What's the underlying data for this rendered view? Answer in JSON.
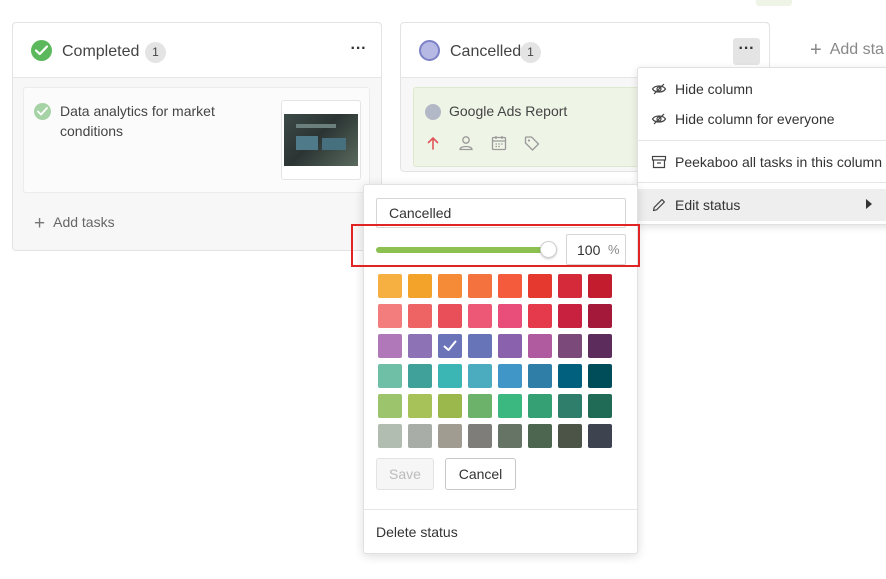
{
  "board": {
    "add_status_label": "Add sta",
    "columns": [
      {
        "title": "Completed",
        "count": "1",
        "more_label": "···",
        "tasks": [
          {
            "title": "Data analytics for market conditions"
          }
        ],
        "add_tasks_label": "Add tasks"
      },
      {
        "title": "Cancelled",
        "count": "1",
        "more_label": "···",
        "tasks": [
          {
            "title": "Google Ads Report"
          }
        ]
      }
    ]
  },
  "column_menu": {
    "items": [
      {
        "label": "Hide column",
        "icon": "eye-off-icon"
      },
      {
        "label": "Hide column for everyone",
        "icon": "eye-off-icon"
      },
      {
        "label": "Peekaboo all tasks in this column",
        "icon": "archive-icon"
      },
      {
        "label": "Edit status",
        "icon": "pencil-icon",
        "highlighted": true
      }
    ]
  },
  "edit_status_panel": {
    "name_value": "Cancelled",
    "opacity_value": "100",
    "opacity_unit": "%",
    "opacity_fraction": 1.0,
    "selected_color": "#6b74b8",
    "swatches": [
      "#f6b042",
      "#f4a32a",
      "#f68b37",
      "#f4723d",
      "#f45a3c",
      "#e5382f",
      "#d52a3a",
      "#c21c2e",
      "#f37c7c",
      "#ee6464",
      "#e84f58",
      "#ec5875",
      "#e94d7a",
      "#e43a4c",
      "#c8203f",
      "#a4183a",
      "#b078b8",
      "#8e72b6",
      "#6b74b8",
      "#6774b8",
      "#8a61ad",
      "#b05b9f",
      "#7b4a7a",
      "#5c2d5c",
      "#6fbfa7",
      "#3fa19a",
      "#3cb6b4",
      "#4bacbf",
      "#3f96c7",
      "#2f7ea8",
      "#00607e",
      "#004d5a",
      "#9cc46d",
      "#a8c25a",
      "#9bb84c",
      "#6cb26a",
      "#3bb87f",
      "#35a073",
      "#2e7e6b",
      "#1f6b56",
      "#b0bdb0",
      "#a9ada7",
      "#a19c92",
      "#7f7d7a",
      "#667466",
      "#4c6650",
      "#4c5448",
      "#3d4450"
    ],
    "save_label": "Save",
    "cancel_label": "Cancel",
    "delete_label": "Delete status"
  },
  "colors": {
    "completed": "#5cb85c",
    "cancelled_ring": "#7d82c6",
    "slider_fill": "#8cc152",
    "highlight": "#e02424"
  }
}
